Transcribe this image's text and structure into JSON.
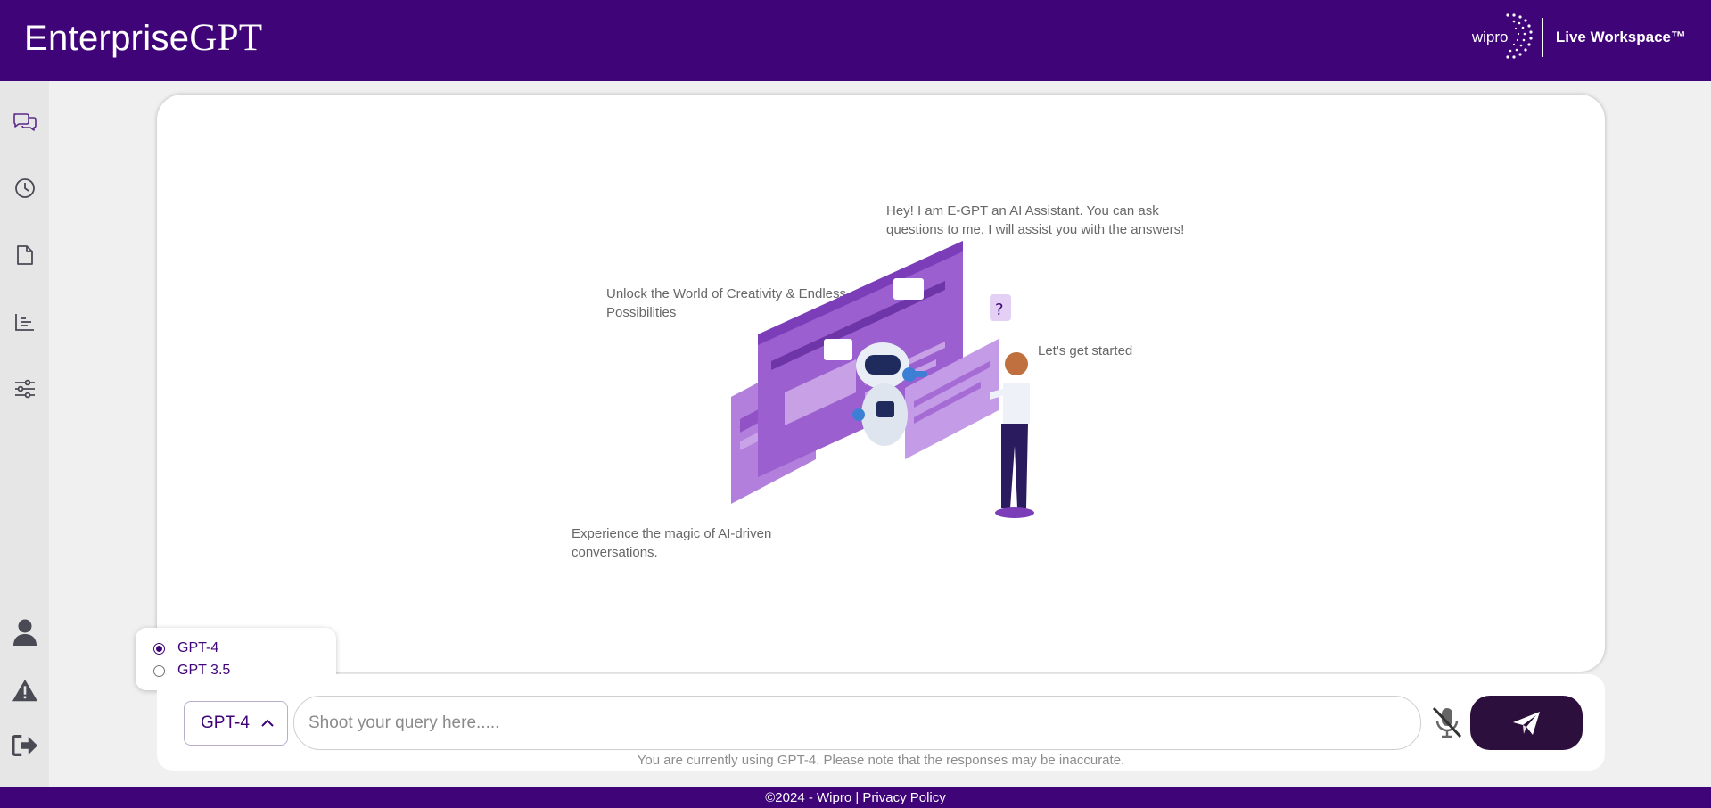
{
  "header": {
    "brand_part1": "Enterprise",
    "brand_part2": "GPT",
    "partner_logo_text": "wipro",
    "workspace_label": "Live Workspace™"
  },
  "sidebar": {
    "top_items": [
      {
        "icon": "chat-icon",
        "label": "Chat"
      },
      {
        "icon": "history-icon",
        "label": "History"
      },
      {
        "icon": "document-icon",
        "label": "Documents"
      },
      {
        "icon": "analytics-icon",
        "label": "Analytics"
      },
      {
        "icon": "settings-sliders-icon",
        "label": "Settings"
      }
    ],
    "bottom_items": [
      {
        "icon": "user-icon"
      },
      {
        "icon": "warning-icon"
      },
      {
        "icon": "logout-icon"
      }
    ]
  },
  "welcome": {
    "assistant_intro": "Hey! I am E-GPT an AI Assistant. You can ask questions to me, I will assist you with the answers!",
    "creativity": "Unlock the World of Creativity & Endless Possibilities",
    "get_started": "Let's get started",
    "magic": "Experience the magic of AI-driven conversations."
  },
  "model_menu": {
    "options": [
      {
        "label": "GPT-4",
        "selected": true
      },
      {
        "label": "GPT 3.5",
        "selected": false
      }
    ]
  },
  "composer": {
    "selected_model": "GPT-4",
    "placeholder": "Shoot your query here.....",
    "value": "",
    "disclaimer": "You are currently using GPT-4. Please note that the responses may be inaccurate."
  },
  "footer": {
    "copyright": "©2024 - Wipro",
    "separator": " | ",
    "privacy_link": "Privacy Policy"
  },
  "colors": {
    "brand_purple": "#3f0478",
    "send_button": "#2d0f3d",
    "illustration_purple": "#a66cd6"
  }
}
